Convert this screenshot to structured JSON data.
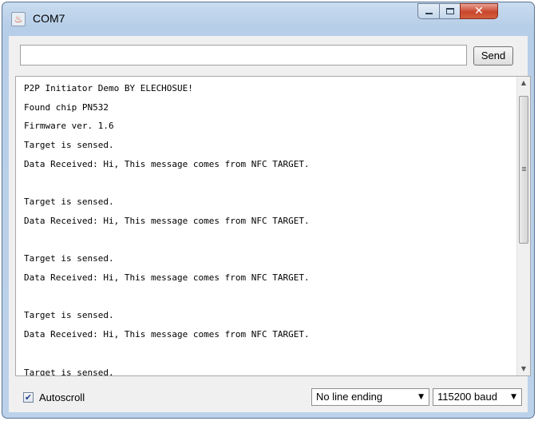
{
  "window": {
    "title": "COM7",
    "app_icon_glyph": "♨"
  },
  "titlebar_controls": {
    "close_glyph": "✕"
  },
  "send": {
    "input_value": "",
    "button_label": "Send"
  },
  "monitor": {
    "lines": [
      "P2P Initiator Demo BY ELECHOSUE!",
      "Found chip PN532",
      "Firmware ver. 1.6",
      "Target is sensed.",
      "Data Received: Hi, This message comes from NFC TARGET.",
      "",
      "Target is sensed.",
      "Data Received: Hi, This message comes from NFC TARGET.",
      "",
      "Target is sensed.",
      "Data Received: Hi, This message comes from NFC TARGET.",
      "",
      "Target is sensed.",
      "Data Received: Hi, This message comes from NFC TARGET.",
      "",
      "Target is sensed."
    ]
  },
  "footer": {
    "autoscroll_label": "Autoscroll",
    "autoscroll_checked": true,
    "check_glyph": "✔",
    "line_ending": "No line ending",
    "baud": "115200 baud"
  },
  "icons": {
    "up_arrow": "▲",
    "down_arrow": "▼",
    "dropdown_arrow": "▼"
  }
}
